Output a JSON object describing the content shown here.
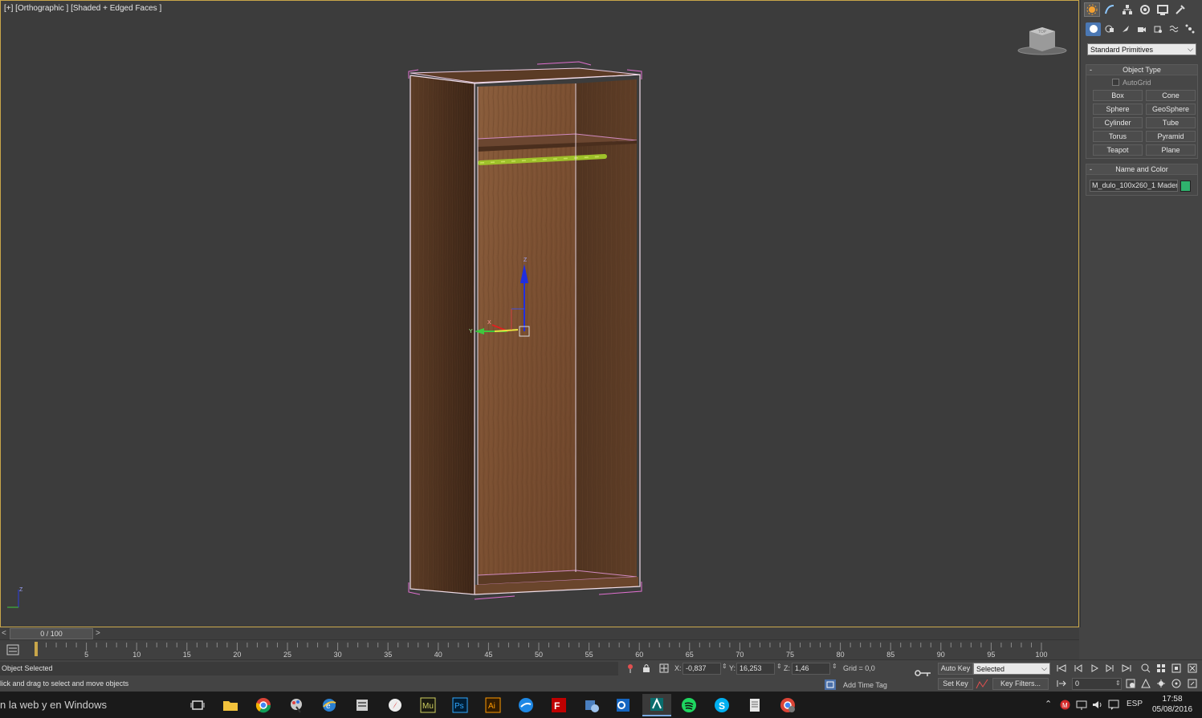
{
  "viewport": {
    "label": "[+] [Orthographic ] [Shaded + Edged Faces ]",
    "viewcube_label": "TOP",
    "axis_labels": {
      "x": "X",
      "y": "Y",
      "z": "Z"
    }
  },
  "command_panel": {
    "tabs": [
      "create-icon",
      "modify-icon",
      "hierarchy-icon",
      "motion-icon",
      "display-icon",
      "utilities-icon"
    ],
    "subtabs": [
      "geometry-icon",
      "shapes-icon",
      "lights-icon",
      "cameras-icon",
      "helpers-icon",
      "space-warps-icon",
      "systems-icon"
    ],
    "category": "Standard Primitives",
    "object_type": {
      "title": "Object Type",
      "collapse": "-",
      "autogrid": "AutoGrid",
      "buttons": [
        "Box",
        "Cone",
        "Sphere",
        "GeoSphere",
        "Cylinder",
        "Tube",
        "Torus",
        "Pyramid",
        "Teapot",
        "Plane"
      ]
    },
    "name_color": {
      "title": "Name and Color",
      "collapse": "-",
      "name": "M_dulo_100x260_1 Madera",
      "color": "#2fb26d"
    }
  },
  "time_slider": {
    "left_arrow": "<",
    "position": "0 / 100",
    "right_arrow": ">"
  },
  "trackbar": {
    "labels": [
      "5",
      "10",
      "15",
      "20",
      "25",
      "30",
      "35",
      "40",
      "45",
      "50",
      "55",
      "60",
      "65",
      "70",
      "75",
      "80",
      "85",
      "90",
      "95",
      "100"
    ],
    "current_frame": 0
  },
  "status": {
    "message": "Object Selected",
    "prompt": "lick and drag to select and move objects",
    "x_label": "X:",
    "x_value": "-0,837",
    "y_label": "Y:",
    "y_value": "16,253",
    "z_label": "Z:",
    "z_value": "1,46",
    "grid": "Grid = 0,0",
    "add_time_tag": "Add Time Tag",
    "auto_key": "Auto Key",
    "set_key": "Set Key",
    "selected_option": "Selected",
    "key_filters": "Key Filters...",
    "frame": "0"
  },
  "taskbar": {
    "search": "n la web y en Windows",
    "apps": [
      "task-view-icon",
      "file-explorer-icon",
      "chrome-icon",
      "paint-icon",
      "edge-like-icon",
      "document-icon",
      "compass-icon",
      "muse-icon",
      "photoshop-icon",
      "illustrator-icon",
      "app-blue-icon",
      "filezilla-icon",
      "outlook-icon",
      "app-blue2-icon",
      "3dsmax-icon",
      "spotify-icon",
      "skype-icon",
      "notepad-icon",
      "chrome-alt-icon"
    ],
    "app_labels": {
      "muse": "Mu",
      "photoshop": "Ps",
      "illustrator": "Ai"
    },
    "language": "ESP",
    "time": "17:58",
    "date": "05/08/2016"
  }
}
